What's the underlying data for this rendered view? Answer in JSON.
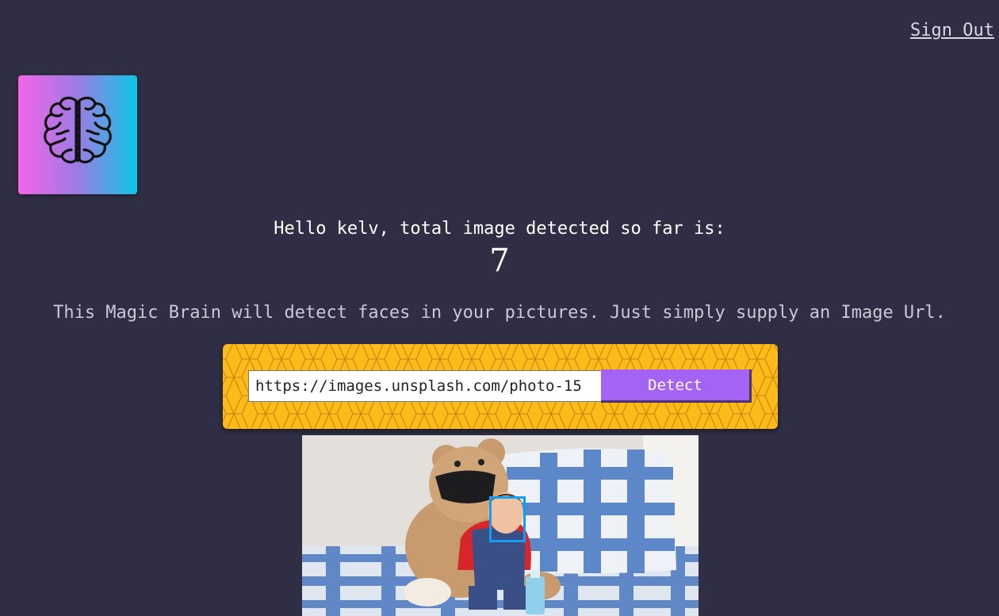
{
  "header": {
    "sign_out_label": "Sign Out"
  },
  "logo": {
    "icon": "brain-icon",
    "gradient": [
      "#f465e6",
      "#0ec7e4"
    ]
  },
  "rank": {
    "greeting": "Hello kelv, total image detected so far is:",
    "count": "7"
  },
  "tagline": "This Magic Brain will detect faces in your pictures. Just simply supply an Image Url.",
  "form": {
    "url_value": "https://images.unsplash.com/photo-15",
    "detect_label": "Detect",
    "background_color": "#fdbb1a",
    "button_color": "#a463f2"
  },
  "result": {
    "image_description_icon": "photo-baby-teddy-bear",
    "face_box_color": "#149df2"
  }
}
